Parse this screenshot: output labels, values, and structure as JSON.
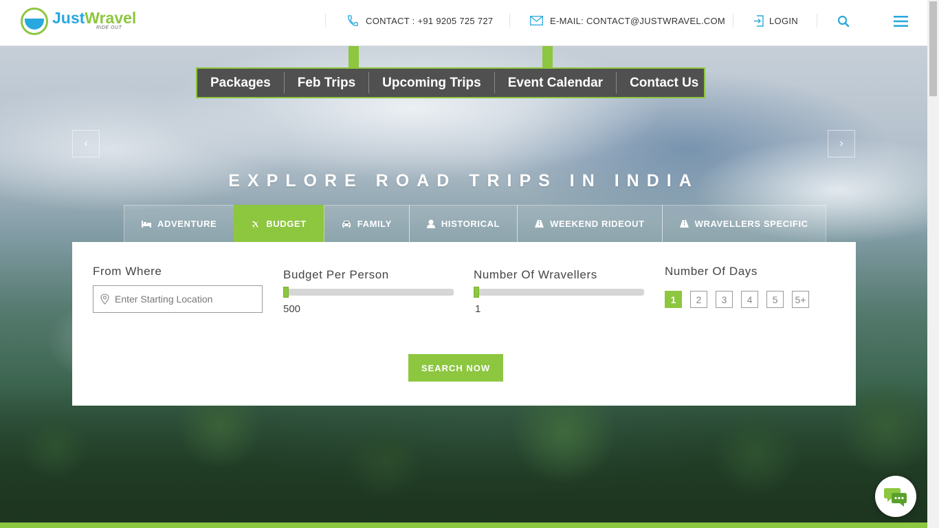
{
  "header": {
    "logo_text_1": "Just",
    "logo_text_2": "Wravel",
    "logo_tagline": "RIDE OUT",
    "contact_label": "CONTACT : +91 9205 725 727",
    "email_label": "E-MAIL: CONTACT@JUSTWRAVEL.COM",
    "login_label": "LOGIN",
    "icons": {
      "phone": "phone-icon",
      "mail": "envelope-icon",
      "login": "login-icon",
      "search": "search-icon",
      "menu": "hamburger-menu-icon"
    }
  },
  "nav": {
    "items": [
      {
        "label": "Packages"
      },
      {
        "label": "Feb Trips"
      },
      {
        "label": "Upcoming Trips"
      },
      {
        "label": "Event Calendar"
      },
      {
        "label": "Contact Us"
      }
    ]
  },
  "slider": {
    "prev": "‹",
    "next": "›"
  },
  "hero": {
    "title": "EXPLORE ROAD TRIPS IN INDIA"
  },
  "tabs": [
    {
      "label": "ADVENTURE",
      "icon": "bed-icon"
    },
    {
      "label": "BUDGET",
      "icon": "plane-icon",
      "active": true
    },
    {
      "label": "FAMILY",
      "icon": "car-icon"
    },
    {
      "label": "HISTORICAL",
      "icon": "user-icon"
    },
    {
      "label": "WEEKEND RIDEOUT",
      "icon": "road-icon"
    },
    {
      "label": "WRAVELLERS SPECIFIC",
      "icon": "road-icon"
    }
  ],
  "search": {
    "from_label": "From Where",
    "from_placeholder": "Enter Starting Location",
    "budget_label": "Budget Per Person",
    "budget_value": "500",
    "wravellers_label": "Number Of Wravellers",
    "wravellers_value": "1",
    "days_label": "Number Of Days",
    "days_options": [
      "1",
      "2",
      "3",
      "4",
      "5",
      "5+"
    ],
    "days_selected": "1",
    "button_label": "SEARCH NOW"
  },
  "colors": {
    "accent": "#8dc63f",
    "brand_blue": "#29a8df",
    "nav_bg": "#505050"
  }
}
